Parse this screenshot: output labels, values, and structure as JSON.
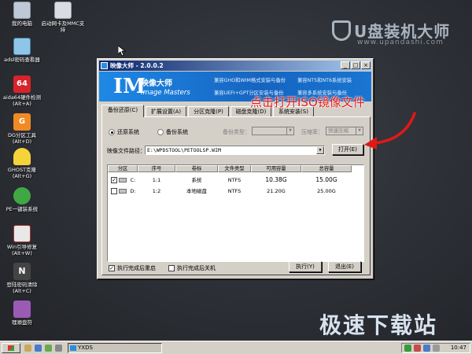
{
  "watermarks": {
    "top_main": "U盘装机大师",
    "top_sub": "www.upandashi.com",
    "bottom": "极速下载站"
  },
  "desktop_icons": [
    {
      "label": "我的电脑",
      "color": "#bfc8d6"
    },
    {
      "label": "启动网卡及MMC支持",
      "color": "#d9dde3"
    },
    {
      "label": "adsl密码查看器",
      "color": "#8ec6e8"
    },
    {
      "label": "aida64硬件检测(Alt+A)",
      "color": "#d8232a"
    },
    {
      "label": "DG分区工具(Alt+D)",
      "color": "#f08a24"
    },
    {
      "label": "GHOST克隆(Alt+G)",
      "color": "#f5d33a"
    },
    {
      "label": "PE一键装系统",
      "color": "#3fa844"
    },
    {
      "label": "Win引导修复(Alt+W)",
      "color": "#e8e8e8"
    },
    {
      "label": "登陆密码清除(Alt+C)",
      "color": "#444444"
    },
    {
      "label": "理顺盘符",
      "color": "#9b5bb5"
    }
  ],
  "window": {
    "title": "映像大师 - 2.0.0.2",
    "banner": {
      "logo": "IM",
      "title": "映像大师",
      "subtitle": "Image Masters",
      "features": [
        "兼容GHO和WIM格式安装与备份",
        "兼容NT5和NT6系统安装",
        "兼容UEFI+GPT分区安装与备份",
        "兼容多系统安装与备份"
      ]
    },
    "tabs": [
      "备份还原(C)",
      "扩展设置(A)",
      "分区克隆(P)",
      "磁盘克隆(D)",
      "系统安装(S)"
    ],
    "active_tab": 0,
    "radio_restore": "还原系统",
    "radio_backup": "备份系统",
    "selected_mode": "还原系统",
    "backup_type_label": "备份类型：",
    "backup_type_value": "",
    "compress_label": "压缩率：",
    "compress_value": "快速压缩",
    "path_label": "映像文件路径：",
    "path_value": "E:\\WPDSTOOL\\PETOOLSP.WIM",
    "open_button": "打开(E)",
    "table": {
      "headers": [
        "分区",
        "序号",
        "卷标",
        "文件类型",
        "可用容量",
        "总容量"
      ],
      "rows": [
        {
          "checked": true,
          "drive": "C:",
          "index": "1:1",
          "label": "系统",
          "fs": "NTFS",
          "free": "10.38G",
          "total": "15.00G"
        },
        {
          "checked": false,
          "drive": "D:",
          "index": "1:2",
          "label": "本地磁盘",
          "fs": "NTFS",
          "free": "21.20G",
          "total": "25.00G"
        }
      ]
    },
    "reboot_checkbox": "执行完成后重启",
    "reboot_checked": true,
    "shutdown_checkbox": "执行完成后关机",
    "shutdown_checked": false,
    "execute_button": "执行(Y)",
    "exit_button": "退出(E)"
  },
  "annotation": "点击打开ISO镜像文件",
  "taskbar": {
    "task_label": "YXDS",
    "clock": "10:47"
  },
  "colors": {
    "annotation": "#e01818",
    "banner": "#1976d2",
    "titlebar": "#0a246a"
  }
}
